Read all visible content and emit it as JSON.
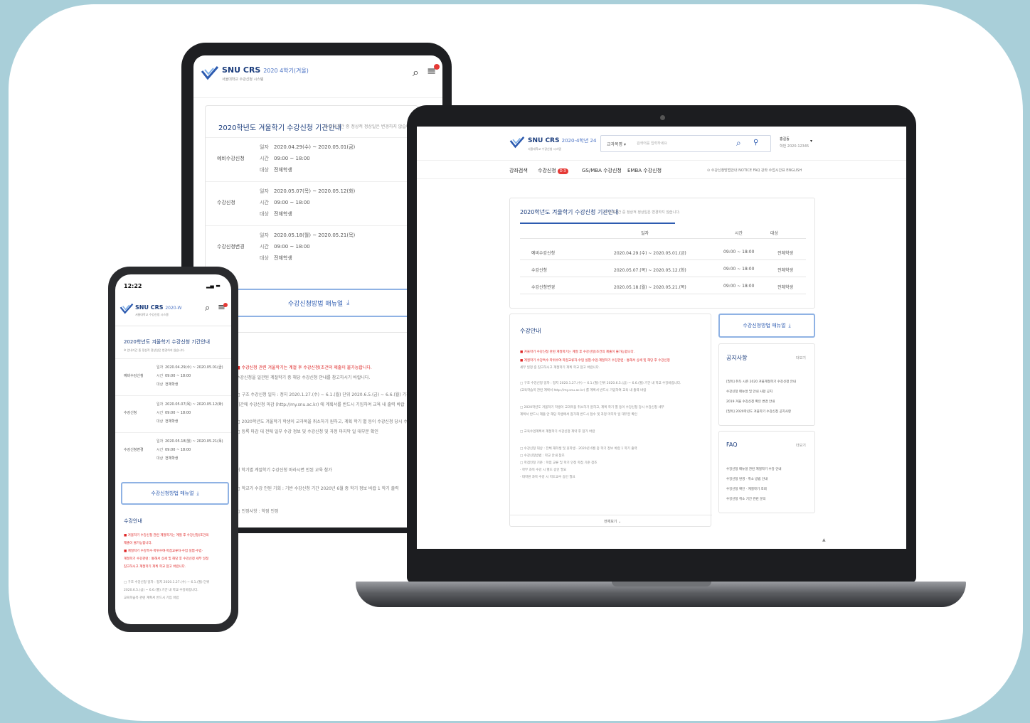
{
  "brand": {
    "name": "SNU CRS",
    "tablet_semester": "2020 4학기(겨울)",
    "laptop_semester": "2020-4학년 24",
    "phone_semester": "2020-W",
    "subtitle": "서울대학교 수강신청 시스템"
  },
  "tablet": {
    "notice_title": "2020학년도 겨울학기 수강신청 기간안내",
    "notice_note": "※ 안내기간 중 정상적 정상일은 변경하지 않습니다.",
    "rows": [
      {
        "label": "예비수강신청",
        "lines": [
          {
            "k": "일자",
            "v": "2020.04.29(수) ~ 2020.05.01(금)"
          },
          {
            "k": "시간",
            "v": "09:00 ~ 18:00"
          },
          {
            "k": "대상",
            "v": "전체학생"
          }
        ]
      },
      {
        "label": "수강신청",
        "lines": [
          {
            "k": "일자",
            "v": "2020.05.07(목) ~ 2020.05.12(화)"
          },
          {
            "k": "시간",
            "v": "09:00 ~ 18:00"
          },
          {
            "k": "대상",
            "v": "전체학생"
          }
        ]
      },
      {
        "label": "수강신청변경",
        "lines": [
          {
            "k": "일자",
            "v": "2020.05.18(월) ~ 2020.05.21(목)"
          },
          {
            "k": "시간",
            "v": "09:00 ~ 18:00"
          },
          {
            "k": "대상",
            "v": "전체학생"
          }
        ]
      }
    ],
    "manual_button": "수강신청방법 매뉴얼",
    "body_lines": [
      "■ 수강신청 관련 겨울학기는 계절 후 수강신청(조건의 제출이 불가능합니다.",
      "수강신청을 일관된 계절학기 중 해당 수강신청 안내를 참고하시기 바랍니다.",
      "□ 구조 수강신청 일자 : 정지 2020.1.27.(수) ~ 6.1.(월) 단위 2020.6.5.(금) ~ 6.6.(월) 기간 내 학교 수강바랍니다.",
      "기간에 수강신청 마감 (http://my.snu.ac.kr) 에 계획서를 반드시 기입하여 교육 내 출력 바랍",
      "□ 2020학년도 겨울학기 학생이 교과목을 취소하기 원하고, 계획 학기 별 등이 수강신청 당시 수강신청 세부 계획",
      "□ 등록 마감 대 전에 일부 수강 정보 및 수강신청 및 과정 마지막 일 대부분 확인",
      "이 학기별 계절학기 수강신청 바라시면 안된 교육 참가",
      "□ 학교가 수강 안된 기회 : 기반 수강신청 기간 2020년 6월 중 학기 정보 바랍 1 학기 출력",
      "□ 인정사항 : 학점 인정"
    ]
  },
  "laptop": {
    "search_category": "교과목명",
    "search_placeholder": "검색어를 입력하세요",
    "user_name": "홍길동",
    "user_sub": "학번 2020-12345",
    "nav": [
      {
        "label": "강좌검색"
      },
      {
        "label": "수강신청",
        "badge": "D-3"
      },
      {
        "label": "GS/MBA 수강신청"
      },
      {
        "label": "EMBA 수강신청"
      }
    ],
    "util_links": "⊙ 수강신청방법안내   NOTICE   FAQ   강좌   수업시간표   ENGLISH",
    "notice_title": "2020학년도 겨울학기 수강신청 기간안내",
    "notice_note": "※ 안내기간 중 정상적 정상일은 변경하지 않습니다.",
    "table_headers": [
      "일자",
      "시간",
      "대상"
    ],
    "table_rows": [
      {
        "label": "예비수강신청",
        "date": "2020.04.29.(수) ~ 2020.05.01.(금)",
        "time": "09:00 ~ 18:00",
        "target": "전체학생"
      },
      {
        "label": "수강신청",
        "date": "2020.05.07.(목) ~ 2020.05.12.(화)",
        "time": "09:00 ~ 18:00",
        "target": "전체학생"
      },
      {
        "label": "수강신청변경",
        "date": "2020.05.18.(월) ~ 2020.05.21.(목)",
        "time": "09:00 ~ 18:00",
        "target": "전체학생"
      }
    ],
    "guide_title": "수강안내",
    "guide_lines": [
      "■ 겨울학기 수강신청 관련 계절학기는 계절 후 수강신청(조건의 제출이 불가능합니다.",
      "■ 계절학기 수강특수·학위수여·학점교류자·수업 실험·수업·계절학기 수강관련 : 통해서 상세 및 해당 후 수강신청",
      "세부 일정 중 참고하시고 계절학기 계획 학교 참고 바랍니다.",
      "□ 구조 수강신청 일자 : 정지 2020.1.27.(수) ~ 6.1.(월) 단위 2020.6.5.(금) ~ 6.6.(월) 기간 내 학교 수강바랍니다.",
      "(교육학습목 관련 계획서 http://my.snu.ac.kr) 를 계획서 반드시 기입하여 교육 내 출력 바랍",
      "□ 2020학년도 겨울학기 학생이 교과목을 취소하기 원하고, 계획 학기 별 등이 수강신청 당시 수강신청 세부",
      "계획서 반드시 제출 안 해당 학생에서 참가해 반드시 접수 및 과정 마지막 일 대부분 확인",
      "□ 교육수업계획서 계절학기 수강신청 계약 후 참가 바랍",
      "□ 수강신청 대상 : 전체 재학생 및 휴학생 · 2020년 6월 중 학기 정보 바랍 1 학기 출력",
      "□ 수강신청방법 : 학교 안내 참조",
      "□ 학점인정 기준 : 학점 교류 및 학기 인정 학점 기준 참조",
      "· 학부 과목 수강 시 별도 승인 필요",
      "· 대학원 과목 수강 시 지도교수 승인 필요"
    ],
    "more_label": "전체보기",
    "manual_button": "수강신청방법 매뉴얼",
    "notice_box_title": "공지사항",
    "faq_title": "FAQ",
    "more_small": "더보기",
    "notices": [
      "[필독] 취득 시즌 2020 겨울계절학기 수강신청 안내",
      "수강신청 매뉴얼 및 안내 사항 공지",
      "2019 겨울 수강신청 확인 변경 안내",
      "[필독] 2020학년도 겨울학기 수강신청 공지사항"
    ],
    "faqs": [
      "수강신청 매뉴얼 관련 계절학기 수강 안내",
      "수강신청 변경 · 취소 방법 안내",
      "수강신청 확인 · 계절학기 조회",
      "수강신청 취소 기간 관련 문의"
    ]
  },
  "phone": {
    "time": "12:22",
    "notice_title": "2020학년도 겨울학기 수강신청 기간안내",
    "notice_note": "※ 안내기간 중 정상적 정상일은 변경하지 않습니다.",
    "rows": [
      {
        "label": "예비수강신청",
        "lines": [
          {
            "k": "일자",
            "v": "2020.04.29(수) ~ 2020.05.01(금)"
          },
          {
            "k": "시간",
            "v": "09:00 ~ 18:00"
          },
          {
            "k": "대상",
            "v": "전체학생"
          }
        ]
      },
      {
        "label": "수강신청",
        "lines": [
          {
            "k": "일자",
            "v": "2020.05.07(목) ~ 2020.05.12(화)"
          },
          {
            "k": "시간",
            "v": "09:00 ~ 18:00"
          },
          {
            "k": "대상",
            "v": "전체학생"
          }
        ]
      },
      {
        "label": "수강신청변경",
        "lines": [
          {
            "k": "일자",
            "v": "2020.05.18(월) ~ 2020.05.21(목)"
          },
          {
            "k": "시간",
            "v": "09:00 ~ 18:00"
          },
          {
            "k": "대상",
            "v": "전체학생"
          }
        ]
      }
    ],
    "manual_button": "수강신청방법 매뉴얼",
    "guide_title": "수강안내",
    "guide_lines": [
      "■ 겨울학기 수강신청 관련 계절학기는 계절 후 수강신청(조건의",
      "제출이 불가능합니다.",
      "■ 계절학기 수강특수·학위수여·학점교류자·수업 실험·수업·",
      "계절학기 수강관련 : 통해서 상세 및 해당 후 수강신청 세부 일정",
      "참고하시고 계절학기 계획 학교 참고 바랍니다.",
      "",
      "□ 구조 수강신청 일자 : 정지 2020.1.27.(수) ~ 6.1.(월) 단위",
      "2020.6.5.(금) ~ 6.6.(월) 기간 내 학교 수강바랍니다.",
      "교육학습목 관련 계획서 반드시 기입 바랍"
    ]
  }
}
